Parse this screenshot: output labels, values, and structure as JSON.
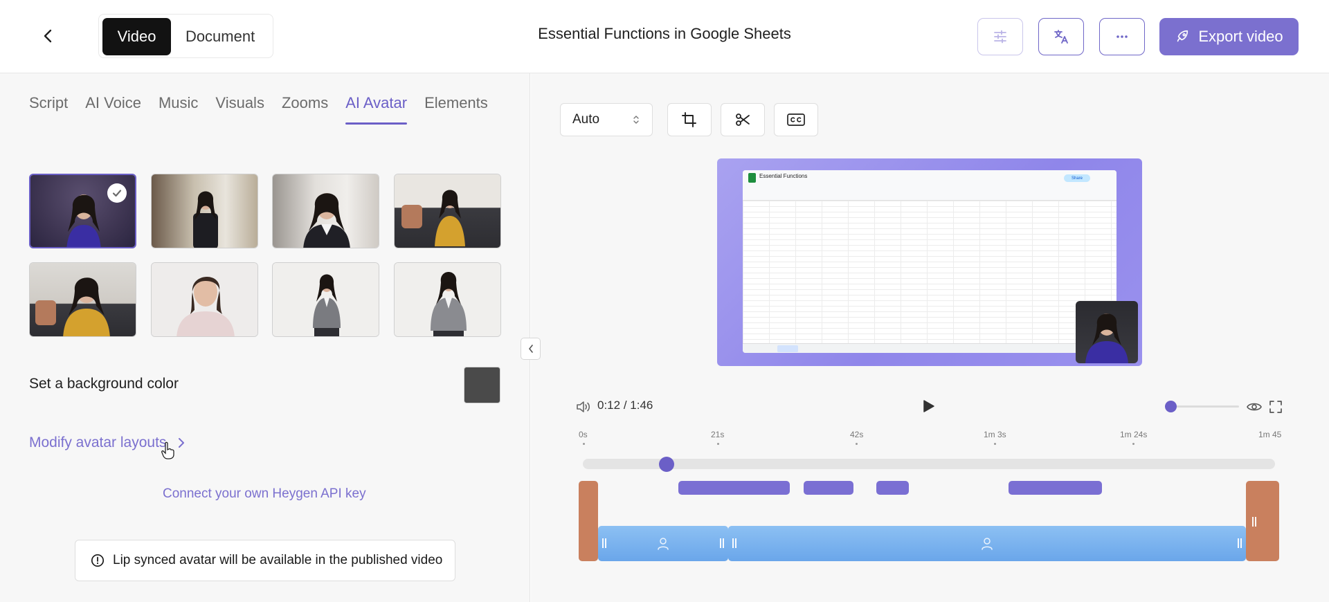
{
  "header": {
    "mode_tabs": [
      "Video",
      "Document"
    ],
    "title": "Essential Functions in Google Sheets",
    "export_label": "Export video"
  },
  "left_tabs": [
    "Script",
    "AI Voice",
    "Music",
    "Visuals",
    "Zooms",
    "AI Avatar",
    "Elements"
  ],
  "background": {
    "label": "Set a background color",
    "color": "#4a4a4a"
  },
  "modify_label": "Modify avatar layouts",
  "connect_label": "Connect your own Heygen API key",
  "notice": "Lip synced avatar will be available in the published video",
  "player": {
    "aspect": "Auto",
    "time_current": "0:12",
    "time_sep": "/",
    "time_total": "1:46"
  },
  "preview": {
    "sheet_title": "Essential Functions",
    "share_label": "Share"
  },
  "timeline": {
    "labels": [
      "0s",
      "21s",
      "42s",
      "1m 3s",
      "1m 24s",
      "1m 45"
    ]
  },
  "colors": {
    "accent": "#6b5fc7",
    "clip": "#7a6fd3",
    "avatar_track": "#6aa6ea",
    "bg_track": "#c9805e"
  }
}
